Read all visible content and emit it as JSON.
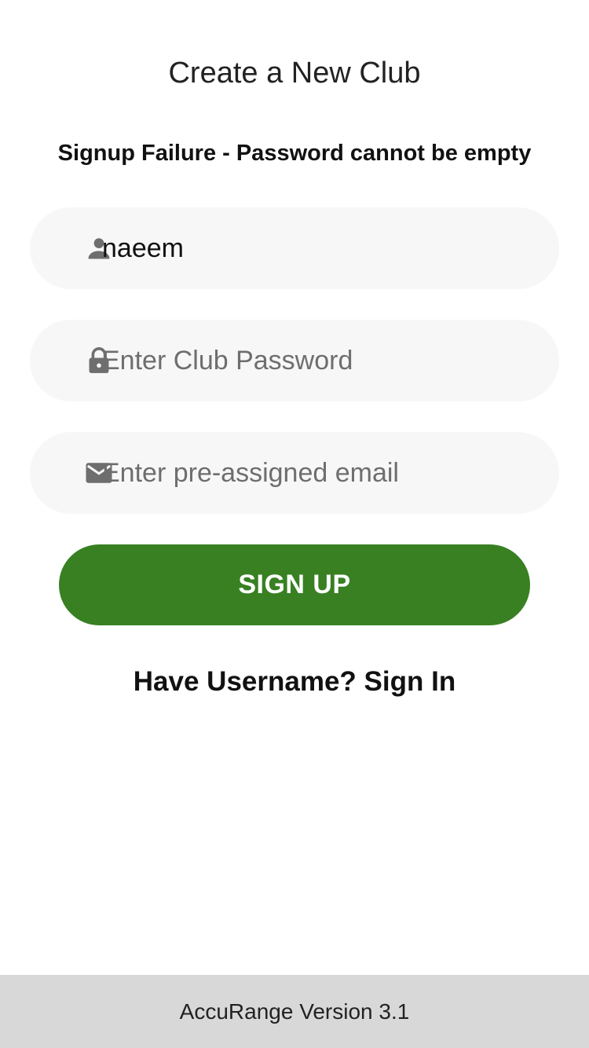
{
  "header": {
    "title": "Create a New Club",
    "error_message": "Signup Failure - Password cannot be empty"
  },
  "form": {
    "username": {
      "value": "naeem",
      "placeholder": "",
      "icon": "person-icon"
    },
    "password": {
      "value": "",
      "placeholder": "Enter Club Password",
      "icon": "lock-icon"
    },
    "email": {
      "value": "",
      "placeholder": "Enter pre-assigned email",
      "icon": "mail-icon"
    },
    "signup_label": "SIGN UP",
    "signin_link_label": "Have Username? Sign In"
  },
  "footer": {
    "version_text": "AccuRange Version 3.1"
  },
  "colors": {
    "accent": "#388022",
    "field_bg": "#f7f7f7",
    "footer_bg": "#d8d8d8",
    "icon": "#6e6e6e"
  }
}
